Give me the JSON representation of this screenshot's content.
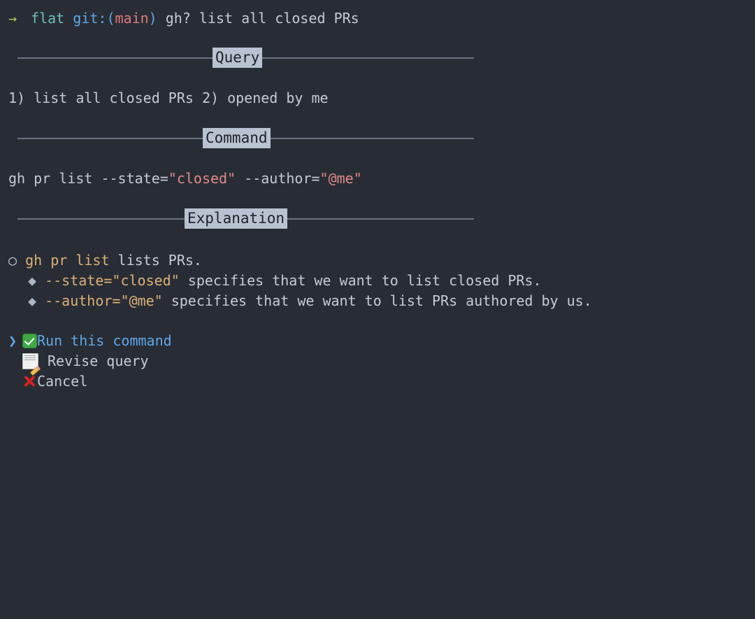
{
  "terminal": {
    "background": "#282c34",
    "foreground": "#c6cbd4",
    "accent_blue": "#5fa8e8",
    "accent_green": "#a9cc5b",
    "accent_red": "#e08a8a",
    "accent_orange": "#dcb079",
    "rule_color": "#6b7385",
    "label_bg": "#b9c2d0",
    "label_fg": "#1f2229"
  },
  "prompt": {
    "arrow": "→",
    "directory": "flat",
    "git_keyword": "git:",
    "paren_open": "(",
    "branch": "main",
    "paren_close": ")",
    "command": "gh? list all closed PRs"
  },
  "sections": {
    "query": {
      "label": "Query",
      "text": "1) list all closed PRs 2) opened by me"
    },
    "command": {
      "label": "Command",
      "parts": [
        {
          "text": "gh pr list --state=",
          "kind": "plain"
        },
        {
          "text": "\"closed\"",
          "kind": "string"
        },
        {
          "text": " --author=",
          "kind": "plain"
        },
        {
          "text": "\"@me\"",
          "kind": "string"
        }
      ],
      "full_text": "gh pr list --state=\"closed\" --author=\"@me\""
    },
    "explanation": {
      "label": "Explanation",
      "items": [
        {
          "bullet": "○",
          "bullet_kind": "circle",
          "indent": 0,
          "code": "gh pr list",
          "rest": " lists PRs."
        },
        {
          "bullet": "◆",
          "bullet_kind": "diamond",
          "indent": 1,
          "code": "--state=\"closed\"",
          "rest": " specifies that we want to list closed PRs."
        },
        {
          "bullet": "◆",
          "bullet_kind": "diamond",
          "indent": 1,
          "code": "--author=\"@me\"",
          "rest": " specifies that we want to list PRs authored by us."
        }
      ]
    }
  },
  "menu": {
    "cursor": "❯",
    "selected_index": 0,
    "items": [
      {
        "icon": "check-mark-emoji",
        "label": "Run this command",
        "selected": true
      },
      {
        "icon": "memo-emoji",
        "label": "Revise query",
        "selected": false
      },
      {
        "icon": "cross-mark-emoji",
        "label": "Cancel",
        "selected": false
      }
    ]
  }
}
